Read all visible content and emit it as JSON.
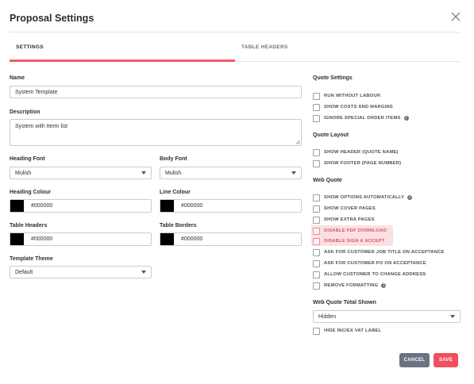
{
  "modal": {
    "title": "Proposal Settings"
  },
  "tabs": [
    {
      "label": "SETTINGS",
      "active": true
    },
    {
      "label": "TABLE HEADERS",
      "active": false
    }
  ],
  "accent_color": "#ef5a63",
  "form": {
    "name": {
      "label": "Name",
      "value": "System Template"
    },
    "description": {
      "label": "Description",
      "value": "System with Iterm list"
    },
    "heading_font": {
      "label": "Heading Font",
      "value": "Mulish"
    },
    "body_font": {
      "label": "Body Font",
      "value": "Mulish"
    },
    "heading_colour": {
      "label": "Heading Colour",
      "value": "#000000"
    },
    "line_colour": {
      "label": "Line Colour",
      "value": "#000000"
    },
    "table_headers": {
      "label": "Table Headers",
      "value": "#000000"
    },
    "table_borders": {
      "label": "Table Borders",
      "value": "#000000"
    },
    "template_theme": {
      "label": "Template Theme",
      "value": "Default"
    }
  },
  "quote_settings": {
    "title": "Quote Settings",
    "items": [
      {
        "label": "RUN WITHOUT LABOUR",
        "checked": false
      },
      {
        "label": "SHOW COSTS AND MARGINS",
        "checked": false
      },
      {
        "label": "IGNORE SPECIAL ORDER ITEMS",
        "checked": false,
        "info": true
      }
    ]
  },
  "quote_layout": {
    "title": "Quote Layout",
    "items": [
      {
        "label": "SHOW HEADER (QUOTE NAME)",
        "checked": false
      },
      {
        "label": "SHOW FOOTER (PAGE NUMBER)",
        "checked": false
      }
    ]
  },
  "web_quote": {
    "title": "Web Quote",
    "items": [
      {
        "label": "SHOW OPTIONS AUTOMATICALLY",
        "checked": false,
        "info": true
      },
      {
        "label": "SHOW COVER PAGES",
        "checked": false
      },
      {
        "label": "SHOW EXTRA PAGES",
        "checked": false
      },
      {
        "label": "DISABLE PDF DOWNLOAD",
        "checked": false,
        "highlighted": true
      },
      {
        "label": "DISABLE SIGN & ACCEPT",
        "checked": false,
        "highlighted": true
      },
      {
        "label": "ASK FOR CUSTOMER JOB TITLE ON ACCEPTANCE",
        "checked": false
      },
      {
        "label": "ASK FOR CUSTOMER PO ON ACCEPTANCE",
        "checked": false
      },
      {
        "label": "ALLOW CUSTOMER TO CHANGE ADDRESS",
        "checked": false
      },
      {
        "label": "REMOVE FORMATTING",
        "checked": false,
        "info": true
      }
    ]
  },
  "web_quote_total": {
    "title": "Web Quote Total Shown",
    "value": "Hidden",
    "extra": {
      "label": "HIDE INC/EX VAT LABEL",
      "checked": false
    }
  },
  "info_glyph": "i",
  "buttons": {
    "cancel": "CANCEL",
    "save": "SAVE"
  }
}
